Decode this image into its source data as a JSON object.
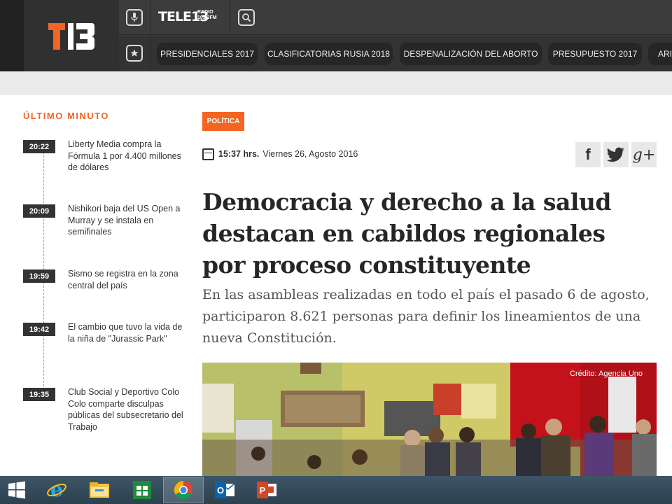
{
  "header": {
    "logo_text": "T13",
    "radio_brand": "TELE13",
    "radio_sub_line1": "RADIO",
    "radio_sub_line2": "103.3FM",
    "nav_pills": [
      "PRESIDENCIALES 2017",
      "CLASIFICATORIAS RUSIA 2018",
      "DESPENALIZACIÓN DEL ABORTO",
      "PRESUPUESTO 2017",
      "ARI"
    ]
  },
  "sidebar": {
    "title": "ÚLTIMO MINUTO",
    "items": [
      {
        "time": "20:22",
        "text": "Liberty Media compra la Fórmula 1 por 4.400 millones de dólares"
      },
      {
        "time": "20:09",
        "text": "Nishikori baja del US Open a Murray y se instala en semifinales"
      },
      {
        "time": "19:59",
        "text": "Sismo se registra en la zona central del país"
      },
      {
        "time": "19:42",
        "text": "El cambio que tuvo la vida de la niña de \"Jurassic Park\""
      },
      {
        "time": "19:35",
        "text": "Club Social y Deportivo Colo Colo comparte disculpas públicas del subsecretario del Trabajo"
      }
    ]
  },
  "article": {
    "category": "POLÍTICA",
    "time": "15:37 hrs.",
    "date": "Viernes 26, Agosto 2016",
    "headline": "Democracia y derecho a la salud destacan en cabildos regionales por proceso constituyente",
    "lead": "En las asambleas realizadas en todo el país el pasado 6 de agosto, participaron 8.621 personas para definir los lineamientos de una nueva Constitución.",
    "photo_credit": "Crédito: Agencia Uno",
    "share": {
      "facebook": "f",
      "twitter": "t",
      "google": "g+"
    }
  },
  "colors": {
    "accent": "#f26522",
    "header_bg": "#3a3a3a",
    "pill_bg": "#262626"
  },
  "taskbar": {
    "apps": [
      "start-icon",
      "internet-explorer-icon",
      "file-explorer-icon",
      "store-icon",
      "chrome-icon",
      "outlook-icon",
      "powerpoint-icon"
    ]
  }
}
